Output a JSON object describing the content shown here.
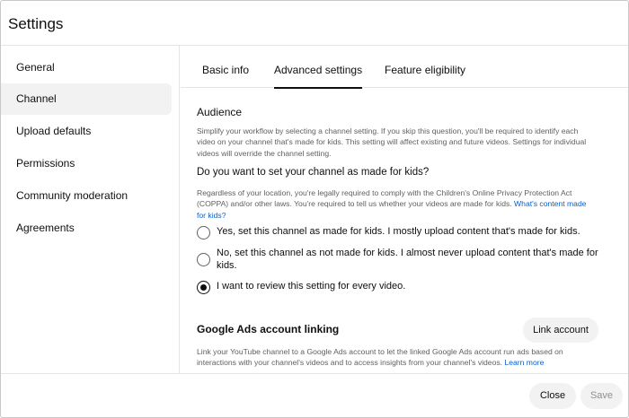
{
  "dialog": {
    "title": "Settings"
  },
  "sidebar": {
    "items": [
      {
        "label": "General"
      },
      {
        "label": "Channel"
      },
      {
        "label": "Upload defaults"
      },
      {
        "label": "Permissions"
      },
      {
        "label": "Community moderation"
      },
      {
        "label": "Agreements"
      }
    ],
    "active": "Channel"
  },
  "tabs": [
    {
      "label": "Basic info"
    },
    {
      "label": "Advanced settings"
    },
    {
      "label": "Feature eligibility"
    }
  ],
  "active_tab": "Advanced settings",
  "audience": {
    "heading": "Audience",
    "description": "Simplify your workflow by selecting a channel setting. If you skip this question, you'll be required to identify each video on your channel that's made for kids. This setting will affect existing and future videos. Settings for individual videos will override the channel setting.",
    "question": "Do you want to set your channel as made for kids?",
    "legal_text": "Regardless of your location, you're legally required to comply with the Children's Online Privacy Protection Act (COPPA) and/or other laws. You're required to tell us whether your videos are made for kids.",
    "legal_link": "What's content made for kids?",
    "options": [
      {
        "label": "Yes, set this channel as made for kids. I mostly upload content that's made for kids."
      },
      {
        "label": "No, set this channel as not made for kids. I almost never upload content that's made for kids."
      },
      {
        "label": "I want to review this setting for every video."
      }
    ],
    "selected": "I want to review this setting for every video."
  },
  "ads": {
    "heading": "Google Ads account linking",
    "button_label": "Link account",
    "description": "Link your YouTube channel to a Google Ads account to let the linked Google Ads account run ads based on interactions with your channel's videos and to access insights from your channel's videos.",
    "learn_more": "Learn more"
  },
  "footer": {
    "close_label": "Close",
    "save_label": "Save"
  }
}
